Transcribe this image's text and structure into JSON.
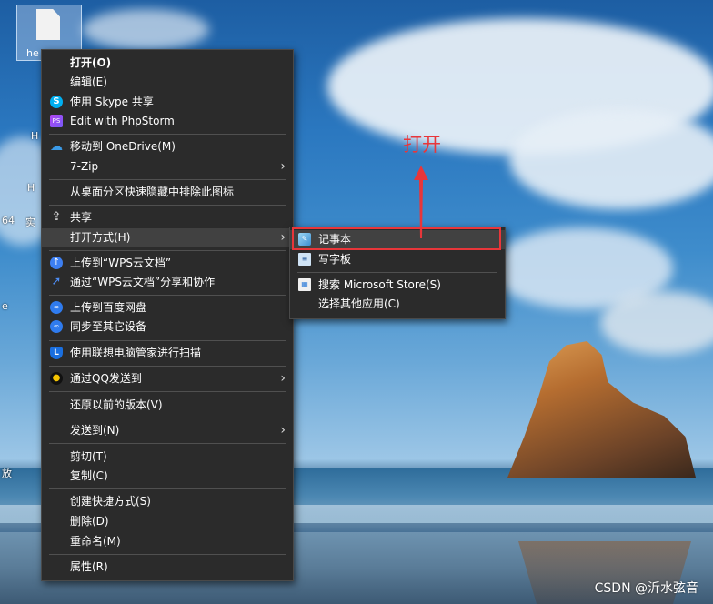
{
  "desktop": {
    "file_icon_label": "he",
    "edge_labels": [
      "H",
      "H",
      "64",
      "实",
      "e",
      "放"
    ],
    "watermark": "CSDN @沂水弦音"
  },
  "annotation": {
    "text": "打开",
    "color": "#e8363a"
  },
  "context_menu": {
    "items": [
      {
        "label": "打开(O)",
        "icon": "",
        "bold": true
      },
      {
        "label": "编辑(E)",
        "icon": ""
      },
      {
        "label": "使用 Skype 共享",
        "icon": "skype-icon"
      },
      {
        "label": "Edit with PhpStorm",
        "icon": "phpstorm-icon"
      },
      {
        "label": "移动到 OneDrive(M)",
        "icon": "onedrive-icon"
      },
      {
        "label": "7-Zip",
        "icon": "",
        "submenu": true
      },
      {
        "label": "从桌面分区快速隐藏中排除此图标",
        "icon": ""
      },
      {
        "label": "共享",
        "icon": "share-icon"
      },
      {
        "label": "打开方式(H)",
        "icon": "",
        "submenu": true,
        "hover": true
      },
      {
        "label": "上传到“WPS云文档”",
        "icon": "wps-upload-icon"
      },
      {
        "label": "通过“WPS云文档”分享和协作",
        "icon": "wps-share-icon"
      },
      {
        "label": "上传到百度网盘",
        "icon": "baidu-netdisk-icon"
      },
      {
        "label": "同步至其它设备",
        "icon": "sync-icon"
      },
      {
        "label": "使用联想电脑管家进行扫描",
        "icon": "lenovo-icon"
      },
      {
        "label": "通过QQ发送到",
        "icon": "qq-icon",
        "submenu": true
      },
      {
        "label": "还原以前的版本(V)",
        "icon": ""
      },
      {
        "label": "发送到(N)",
        "icon": "",
        "submenu": true
      },
      {
        "label": "剪切(T)",
        "icon": ""
      },
      {
        "label": "复制(C)",
        "icon": ""
      },
      {
        "label": "创建快捷方式(S)",
        "icon": ""
      },
      {
        "label": "删除(D)",
        "icon": ""
      },
      {
        "label": "重命名(M)",
        "icon": ""
      },
      {
        "label": "属性(R)",
        "icon": ""
      }
    ]
  },
  "open_with_submenu": {
    "items": [
      {
        "label": "记事本",
        "icon": "notepad-icon",
        "highlighted": true
      },
      {
        "label": "写字板",
        "icon": "wordpad-icon"
      },
      {
        "label": "搜索 Microsoft Store(S)",
        "icon": "store-icon"
      },
      {
        "label": "选择其他应用(C)",
        "icon": ""
      }
    ]
  }
}
